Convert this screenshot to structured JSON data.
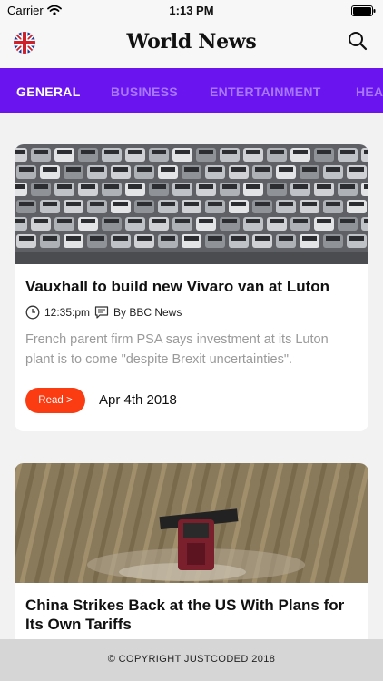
{
  "status_bar": {
    "carrier": "Carrier",
    "time": "1:13 PM"
  },
  "header": {
    "title": "World News",
    "flag_icon": "uk-flag-icon",
    "search_icon": "search-icon"
  },
  "tabs": [
    {
      "label": "GENERAL",
      "active": true
    },
    {
      "label": "BUSINESS",
      "active": false
    },
    {
      "label": "ENTERTAINMENT",
      "active": false
    },
    {
      "label": "HEALTH",
      "active": false
    }
  ],
  "colors": {
    "accent": "#6a14f0",
    "tab_inactive": "#a877ff",
    "read_button": "#fb3c12",
    "footer": "#d6d6d6"
  },
  "articles": [
    {
      "title": "Vauxhall to build new Vivaro van at Luton",
      "time": "12:35:pm",
      "source": "By BBC News",
      "description": "French parent firm PSA says investment at its Luton plant is to come \"despite Brexit uncertainties\".",
      "read_label": "Read >",
      "date": "Apr 4th 2018"
    },
    {
      "title": "China Strikes Back at the US With Plans for Its Own Tariffs"
    }
  ],
  "footer": {
    "copyright": "© COPYRIGHT JUSTCODED 2018"
  }
}
